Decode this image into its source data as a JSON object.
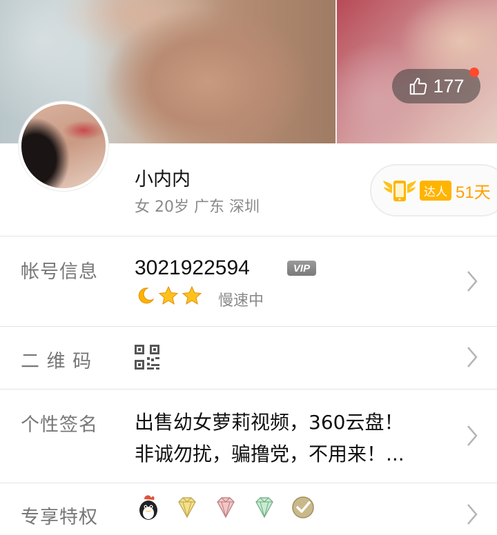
{
  "cover": {
    "likes_count": "177"
  },
  "profile": {
    "nickname": "小内内",
    "meta": "女 20岁 广东 深圳",
    "talent_label": "达人",
    "talent_days": "51天"
  },
  "account": {
    "label": "帐号信息",
    "number": "3021922594",
    "vip_badge": "VIP",
    "speed_status": "慢速中",
    "level_icons": [
      "moon-icon",
      "star-icon",
      "star-icon"
    ]
  },
  "qrcode": {
    "label": "二 维 码"
  },
  "signature": {
    "label": "个性签名",
    "line1": "出售幼女萝莉视频，360云盘！",
    "line2": "非诚勿扰，骗撸党，不用来！..."
  },
  "privileges": {
    "label": "专享特权",
    "icons": [
      "penguin-icon",
      "yellow-diamond-icon",
      "red-diamond-icon",
      "green-diamond-icon",
      "check-medal-icon"
    ]
  },
  "colors": {
    "accent_orange": "#ff9f00",
    "red_dot": "#ff4a2e",
    "label_gray": "#777777"
  }
}
